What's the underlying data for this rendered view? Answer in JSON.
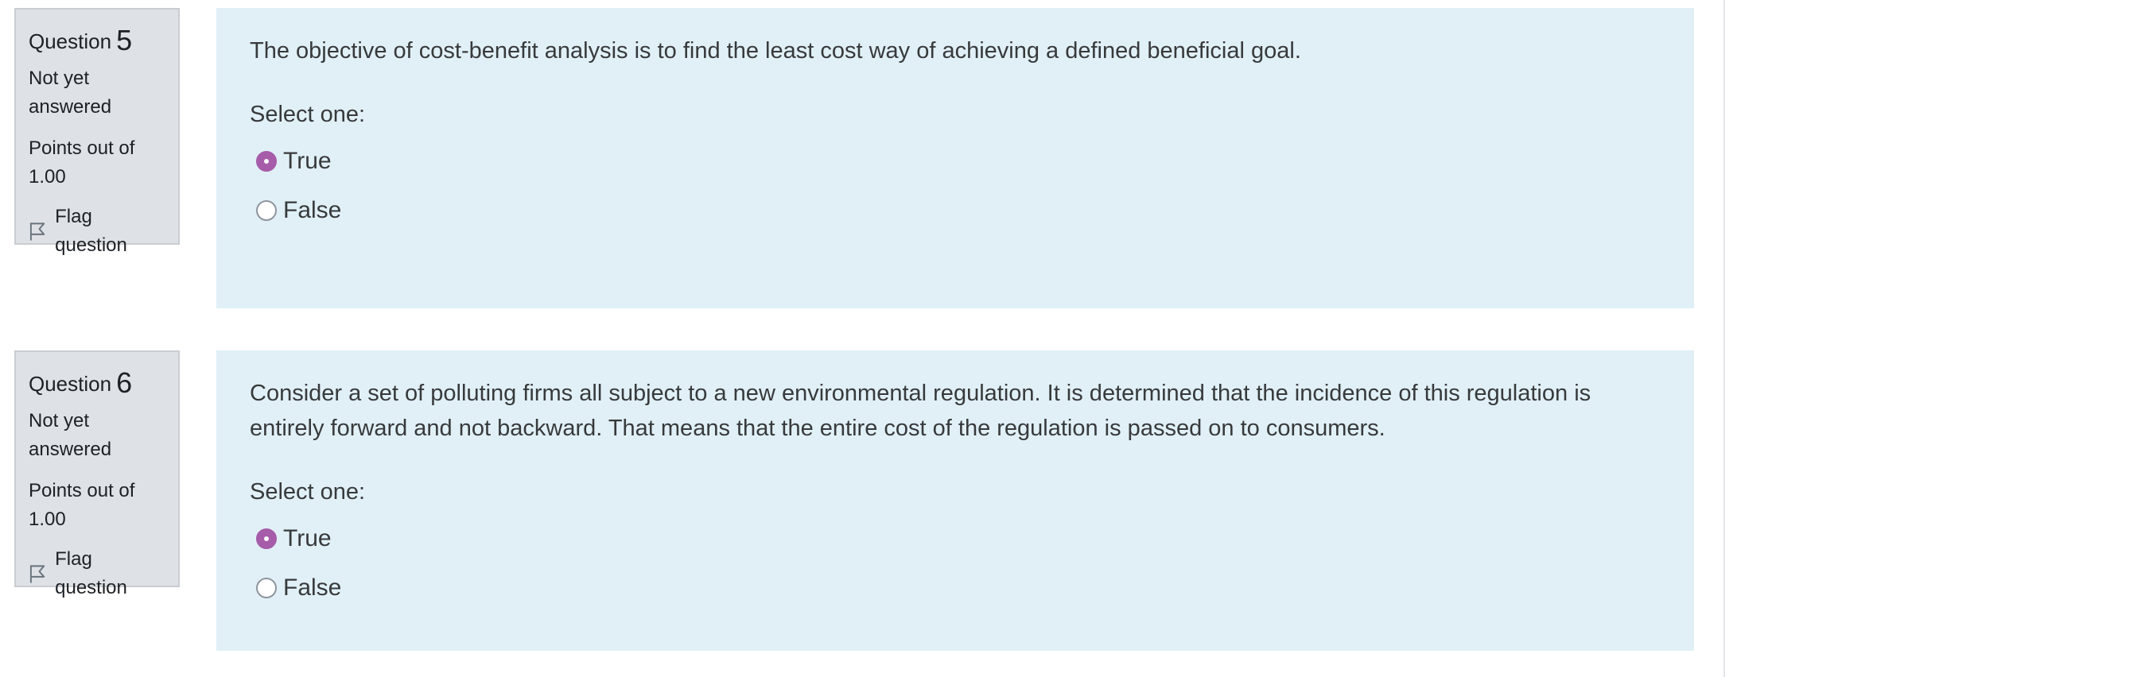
{
  "questions": [
    {
      "label": "Question",
      "number": "5",
      "state": "Not yet answered",
      "grade": "Points out of 1.00",
      "flag_label": "Flag question",
      "text": "The objective of cost-benefit analysis is to find the least cost way of achieving a defined beneficial goal.",
      "prompt": "Select one:",
      "options": [
        {
          "label": "True",
          "selected": true
        },
        {
          "label": "False",
          "selected": false
        }
      ]
    },
    {
      "label": "Question",
      "number": "6",
      "state": "Not yet answered",
      "grade": "Points out of 1.00",
      "flag_label": "Flag question",
      "text": "Consider a set of polluting firms all subject to a new environmental regulation. It is determined that the incidence of this regulation is entirely forward and not backward. That means that the entire cost of the regulation is passed on to consumers.",
      "prompt": "Select one:",
      "options": [
        {
          "label": "True",
          "selected": true
        },
        {
          "label": "False",
          "selected": false
        }
      ]
    }
  ],
  "colors": {
    "info_bg": "#dee2e6",
    "content_bg": "#e1f0f7",
    "radio_selected": "#a65ca9"
  },
  "icons": {
    "flag": "flag-icon"
  }
}
